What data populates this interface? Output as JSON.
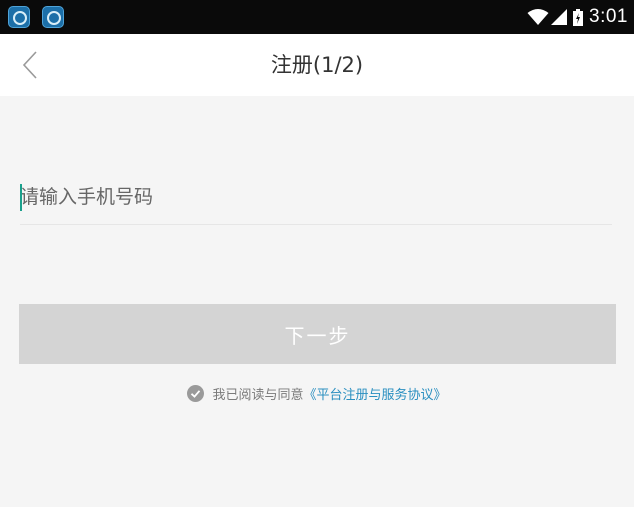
{
  "status_bar": {
    "time": "3:01",
    "icons": [
      "app-notification-icon",
      "app-notification-icon",
      "wifi-icon",
      "signal-icon",
      "battery-icon"
    ]
  },
  "header": {
    "title": "注册(1/2)",
    "back_icon": "chevron-left-icon"
  },
  "form": {
    "phone_placeholder": "请输入手机号码",
    "phone_value": "",
    "next_label": "下一步"
  },
  "agreement": {
    "checked": true,
    "text": "我已阅读与同意",
    "link_label": "《平台注册与服务协议》"
  },
  "colors": {
    "accent_link": "#2a8fc0",
    "button_disabled": "#d4d4d4",
    "background": "#f5f5f5",
    "caret": "#1aa08c"
  }
}
